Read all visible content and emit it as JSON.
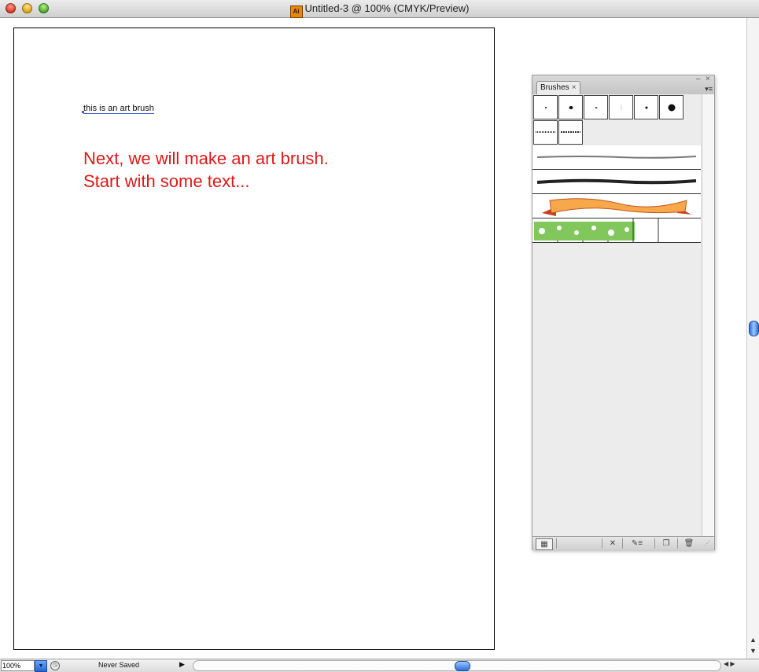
{
  "window": {
    "title": "Untitled-3 @ 100% (CMYK/Preview)",
    "app_icon_label": "Ai"
  },
  "canvas": {
    "small_text": "this is an art brush",
    "instructions": [
      "Next, we will make an art brush.",
      "Start with some text..."
    ]
  },
  "brushes_panel": {
    "tab_label": "Brushes",
    "controls": {
      "collapse": "–",
      "close": "×",
      "tab_close": "×",
      "menu": "▾≡"
    },
    "bottom_icons": [
      "brush-libraries-icon",
      "remove-brush-stroke-icon",
      "brush-options-icon",
      "new-brush-icon",
      "delete-brush-icon"
    ]
  },
  "statusbar": {
    "zoom": "100%",
    "save_status": "Never Saved"
  },
  "colors": {
    "instruction_text": "#e01818",
    "selection": "#3a5bd8",
    "accent": "#2d6fd6"
  }
}
